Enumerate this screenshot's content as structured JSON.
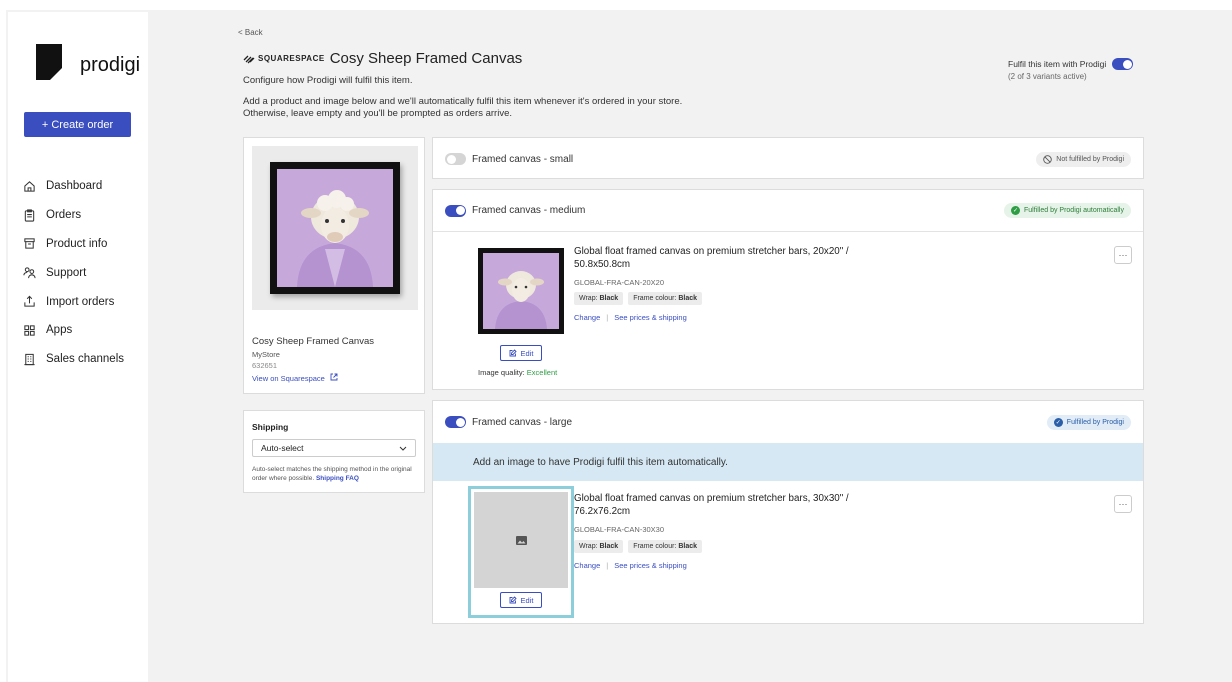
{
  "sidebar": {
    "logo_text": "prodigi",
    "create_order": "+ Create order",
    "items": [
      {
        "label": "Dashboard",
        "icon": "home-icon"
      },
      {
        "label": "Orders",
        "icon": "clipboard-icon"
      },
      {
        "label": "Product info",
        "icon": "box-icon"
      },
      {
        "label": "Support",
        "icon": "users-icon"
      },
      {
        "label": "Import orders",
        "icon": "upload-icon"
      },
      {
        "label": "Apps",
        "icon": "grid-icon"
      },
      {
        "label": "Sales channels",
        "icon": "building-icon"
      }
    ]
  },
  "header": {
    "back": "< Back",
    "platform": "SQUARESPACE",
    "title": "Cosy Sheep Framed Canvas",
    "subtitle": "Configure how Prodigi will fulfil this item.",
    "desc_line1": "Add a product and image below and we'll automatically fulfil this item whenever it's ordered in your store.",
    "desc_line2": "Otherwise, leave empty and you'll be prompted as orders arrive.",
    "fulfil_label": "Fulfil this item with Prodigi",
    "fulfil_sub": "(2 of 3 variants active)"
  },
  "product": {
    "name": "Cosy Sheep Framed Canvas",
    "store": "MyStore",
    "id": "632651",
    "link": "View on Squarespace"
  },
  "shipping": {
    "title": "Shipping",
    "selected": "Auto-select",
    "note": "Auto-select matches the shipping method in the original order where possible.",
    "faq": "Shipping FAQ"
  },
  "variants": {
    "small": {
      "label": "Framed canvas - small",
      "badge": "Not fulfilled by Prodigi"
    },
    "medium": {
      "label": "Framed canvas - medium",
      "badge": "Fulfilled by Prodigi automatically",
      "title_line1": "Global float framed canvas on premium stretcher bars, 20x20\" /",
      "title_line2": "50.8x50.8cm",
      "sku": "GLOBAL-FRA-CAN-20X20",
      "wrap_label": "Wrap:",
      "wrap_value": "Black",
      "frame_label": "Frame colour:",
      "frame_value": "Black",
      "change": "Change",
      "prices": "See prices & shipping",
      "edit": "Edit",
      "quality_label": "Image quality:",
      "quality_value": "Excellent",
      "more": "···"
    },
    "large": {
      "label": "Framed canvas - large",
      "badge": "Fulfilled by Prodigi",
      "info": "Add an image to have Prodigi fulfil this item automatically.",
      "title_line1": "Global float framed canvas on premium stretcher bars, 30x30\" /",
      "title_line2": "76.2x76.2cm",
      "sku": "GLOBAL-FRA-CAN-30X30",
      "wrap_label": "Wrap:",
      "wrap_value": "Black",
      "frame_label": "Frame colour:",
      "frame_value": "Black",
      "change": "Change",
      "prices": "See prices & shipping",
      "edit": "Edit",
      "more": "···"
    }
  },
  "colors": {
    "accent": "#3a4ec0",
    "success": "#2e9e45",
    "info_bg": "#d5e8f3",
    "highlight": "#8ccfda"
  }
}
